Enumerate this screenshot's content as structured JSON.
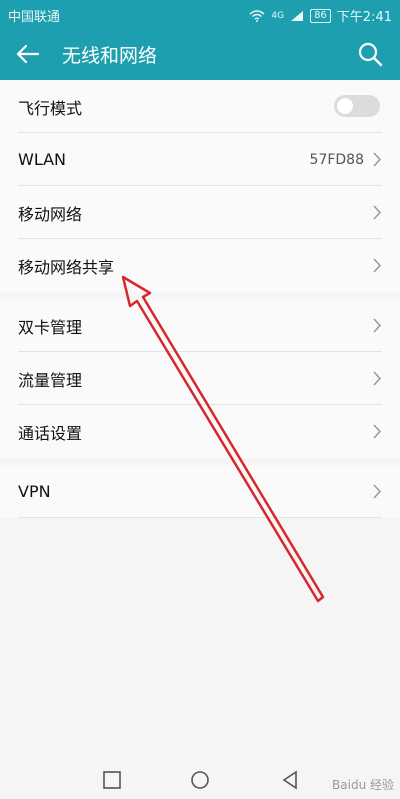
{
  "status_bar": {
    "carrier": "中国联通",
    "network": "4G",
    "battery": "86",
    "time": "下午2:41"
  },
  "header": {
    "title": "无线和网络"
  },
  "section1": [
    {
      "label": "飞行模式",
      "type": "toggle",
      "on": false
    },
    {
      "label": "WLAN",
      "value": "57FD88",
      "type": "chevron"
    },
    {
      "label": "移动网络",
      "type": "chevron"
    },
    {
      "label": "移动网络共享",
      "type": "chevron"
    }
  ],
  "section2": [
    {
      "label": "双卡管理",
      "type": "chevron"
    },
    {
      "label": "流量管理",
      "type": "chevron"
    },
    {
      "label": "通话设置",
      "type": "chevron"
    }
  ],
  "section3": [
    {
      "label": "VPN",
      "type": "chevron"
    }
  ],
  "watermark": "Baidu 经验",
  "colors": {
    "accent": "#1e9fb0",
    "annotation": "#d9262c"
  },
  "icons": [
    "back-arrow-icon",
    "search-icon",
    "chevron-right-icon",
    "square-icon",
    "circle-icon",
    "triangle-back-icon"
  ]
}
